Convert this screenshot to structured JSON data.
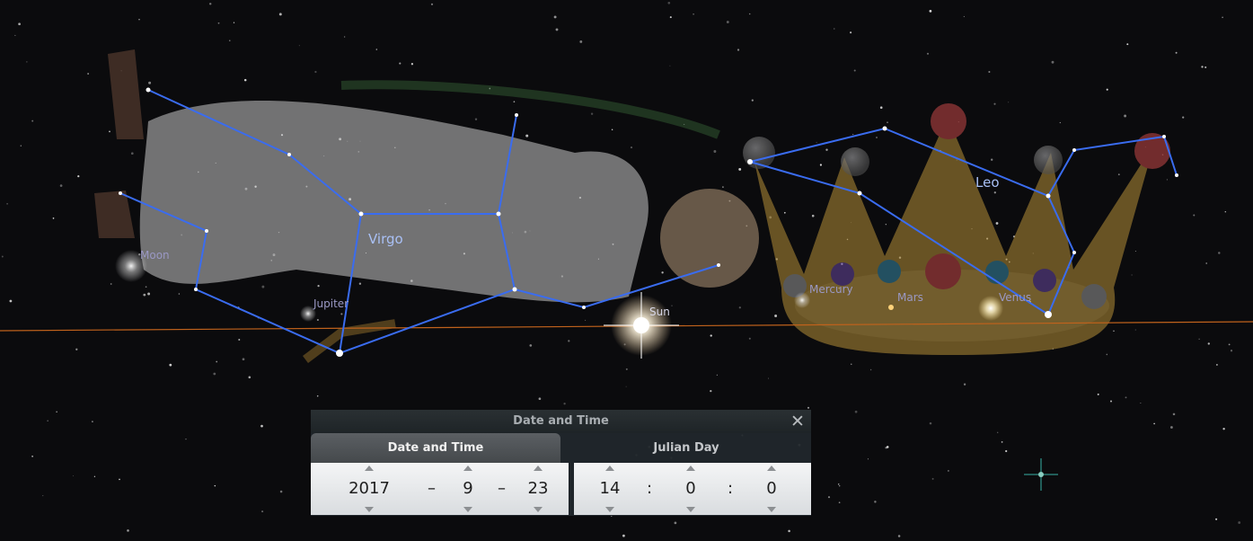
{
  "sky": {
    "constellations": [
      {
        "name": "Virgo"
      },
      {
        "name": "Leo"
      }
    ],
    "objects": [
      {
        "name": "Moon"
      },
      {
        "name": "Jupiter"
      },
      {
        "name": "Sun"
      },
      {
        "name": "Mercury"
      },
      {
        "name": "Mars"
      },
      {
        "name": "Venus"
      }
    ],
    "colors": {
      "constellation_line": "#3a6cf0",
      "constellation_label": "#a9c0f5",
      "planet_label": "#9a98c4",
      "horizon_line": "#c0621c",
      "background": "#0b0b0d"
    }
  },
  "dialog": {
    "title": "Date and Time",
    "close_icon": "close-icon",
    "tabs": [
      {
        "label": "Date and Time",
        "active": true
      },
      {
        "label": "Julian Day",
        "active": false
      }
    ],
    "date": {
      "year": "2017",
      "month": "9",
      "day": "23",
      "separator": "–"
    },
    "time": {
      "hour": "14",
      "minute": "0",
      "second": "0",
      "separator": ":"
    }
  }
}
